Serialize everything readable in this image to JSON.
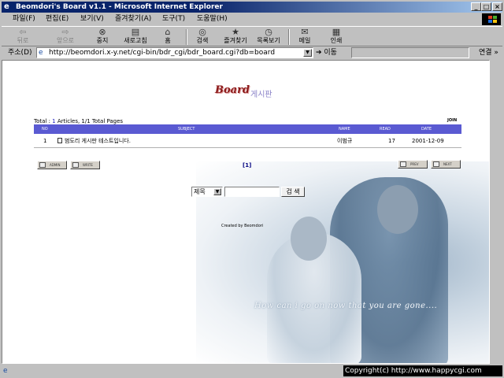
{
  "window": {
    "title": "Beomdori's Board v1.1 - Microsoft Internet Explorer",
    "minimize": "_",
    "maximize": "□",
    "close": "×"
  },
  "menu": [
    "파일(F)",
    "편집(E)",
    "보기(V)",
    "즐겨찾기(A)",
    "도구(T)",
    "도움말(H)"
  ],
  "toolbar": {
    "back": "뒤로",
    "forward": "앞으로",
    "stop": "중지",
    "refresh": "새로고침",
    "home": "홈",
    "search": "검색",
    "favorites": "즐겨찾기",
    "history": "목록보기",
    "mail": "메일",
    "print": "인쇄"
  },
  "address": {
    "label": "주소(D)",
    "url": "http://beomdori.x-y.net/cgi-bin/bdr_cgi/bdr_board.cgi?db=board",
    "go": "이동",
    "links": "연결 »"
  },
  "board": {
    "logo_main": "Board",
    "logo_sub": "게시판",
    "total_prefix": "Total : ",
    "total_articles": "1",
    "total_suffix": " Articles, 1/1 Total Pages",
    "join": "JOIN",
    "columns": {
      "no": "NO",
      "subject": "SUBJECT",
      "name": "NAME",
      "read": "READ",
      "date": "DATE"
    },
    "rows": [
      {
        "no": "1",
        "subject": "범도리 게시판 테스트입니다.",
        "name": "이범규",
        "read": "17",
        "date": "2001-12-09"
      }
    ],
    "admin_btn": "ADMIN",
    "write_btn": "WRITE",
    "prev_btn": "PREV",
    "next_btn": "NEXT",
    "page": "[1]",
    "search_field": "제목",
    "search_button": "검 색",
    "created_by": "Created by Beomdori",
    "photo_caption": "How can i go on now that you are gone...."
  },
  "status": {
    "copyright": "Copyright(c) http://www.happycgi.com"
  }
}
